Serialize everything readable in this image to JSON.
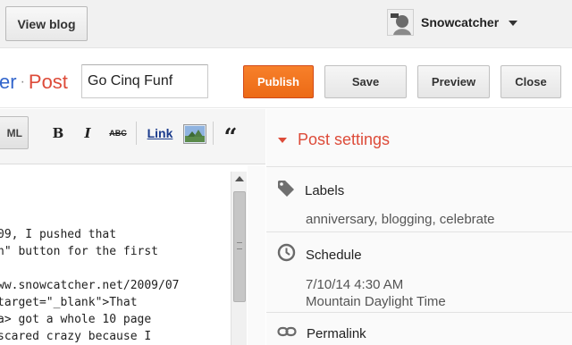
{
  "topbar": {
    "view_blog_label": "View blog",
    "account_name": "Snowcatcher"
  },
  "header": {
    "blog_name_partial": "er",
    "separator": "·",
    "post_label": "Post",
    "title_value": "Go Cinq Funf",
    "publish_label": "Publish",
    "save_label": "Save",
    "preview_label": "Preview",
    "close_label": "Close"
  },
  "toolbar": {
    "html_label": "ML",
    "bold_label": "B",
    "italic_label": "I",
    "strike_label": "ABC",
    "link_label": "Link",
    "quote_label": "“"
  },
  "editor": {
    "lines": [
      "09, I pushed that",
      "n\" button for the first",
      "",
      "ww.snowcatcher.net/2009/07",
      "target=\"_blank\">That",
      "a> got a whole 10 page",
      "scared crazy because I"
    ]
  },
  "settings": {
    "title": "Post settings",
    "labels": {
      "label": "Labels",
      "value": "anniversary, blogging, celebrate"
    },
    "schedule": {
      "label": "Schedule",
      "date": "7/10/14 4:30 AM",
      "tz": "Mountain Daylight Time"
    },
    "permalink": {
      "label": "Permalink"
    }
  },
  "colors": {
    "accent": "#dd4b39",
    "publish": "#f07523",
    "link_blue": "#3366cc"
  },
  "icons": [
    "caret-down-icon",
    "tag-icon",
    "clock-icon",
    "link-chain-icon",
    "image-icon",
    "quote-icon",
    "triangle-down-icon"
  ]
}
